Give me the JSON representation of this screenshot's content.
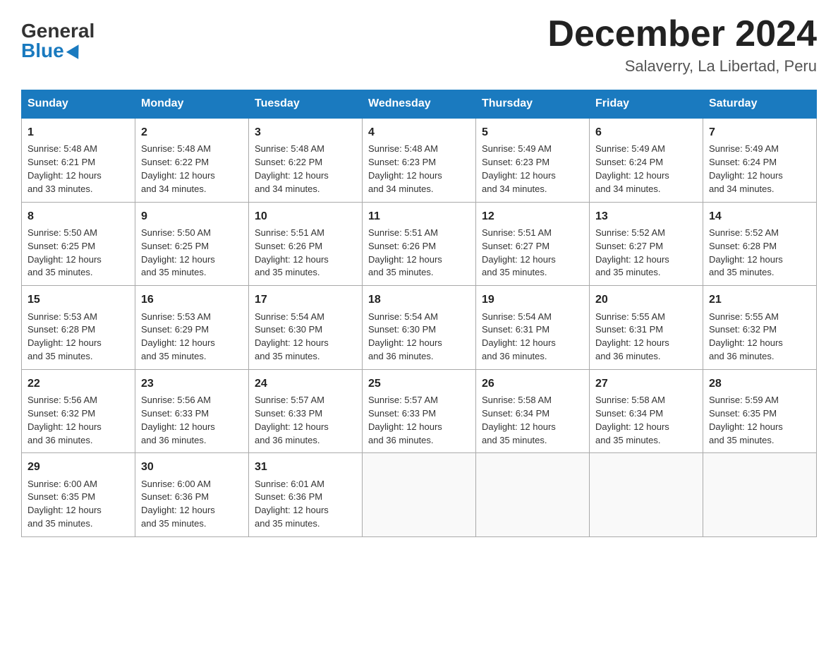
{
  "logo": {
    "general": "General",
    "blue": "Blue"
  },
  "title": "December 2024",
  "subtitle": "Salaverry, La Libertad, Peru",
  "days_of_week": [
    "Sunday",
    "Monday",
    "Tuesday",
    "Wednesday",
    "Thursday",
    "Friday",
    "Saturday"
  ],
  "weeks": [
    [
      {
        "day": "1",
        "sunrise": "5:48 AM",
        "sunset": "6:21 PM",
        "daylight": "12 hours and 33 minutes."
      },
      {
        "day": "2",
        "sunrise": "5:48 AM",
        "sunset": "6:22 PM",
        "daylight": "12 hours and 34 minutes."
      },
      {
        "day": "3",
        "sunrise": "5:48 AM",
        "sunset": "6:22 PM",
        "daylight": "12 hours and 34 minutes."
      },
      {
        "day": "4",
        "sunrise": "5:48 AM",
        "sunset": "6:23 PM",
        "daylight": "12 hours and 34 minutes."
      },
      {
        "day": "5",
        "sunrise": "5:49 AM",
        "sunset": "6:23 PM",
        "daylight": "12 hours and 34 minutes."
      },
      {
        "day": "6",
        "sunrise": "5:49 AM",
        "sunset": "6:24 PM",
        "daylight": "12 hours and 34 minutes."
      },
      {
        "day": "7",
        "sunrise": "5:49 AM",
        "sunset": "6:24 PM",
        "daylight": "12 hours and 34 minutes."
      }
    ],
    [
      {
        "day": "8",
        "sunrise": "5:50 AM",
        "sunset": "6:25 PM",
        "daylight": "12 hours and 35 minutes."
      },
      {
        "day": "9",
        "sunrise": "5:50 AM",
        "sunset": "6:25 PM",
        "daylight": "12 hours and 35 minutes."
      },
      {
        "day": "10",
        "sunrise": "5:51 AM",
        "sunset": "6:26 PM",
        "daylight": "12 hours and 35 minutes."
      },
      {
        "day": "11",
        "sunrise": "5:51 AM",
        "sunset": "6:26 PM",
        "daylight": "12 hours and 35 minutes."
      },
      {
        "day": "12",
        "sunrise": "5:51 AM",
        "sunset": "6:27 PM",
        "daylight": "12 hours and 35 minutes."
      },
      {
        "day": "13",
        "sunrise": "5:52 AM",
        "sunset": "6:27 PM",
        "daylight": "12 hours and 35 minutes."
      },
      {
        "day": "14",
        "sunrise": "5:52 AM",
        "sunset": "6:28 PM",
        "daylight": "12 hours and 35 minutes."
      }
    ],
    [
      {
        "day": "15",
        "sunrise": "5:53 AM",
        "sunset": "6:28 PM",
        "daylight": "12 hours and 35 minutes."
      },
      {
        "day": "16",
        "sunrise": "5:53 AM",
        "sunset": "6:29 PM",
        "daylight": "12 hours and 35 minutes."
      },
      {
        "day": "17",
        "sunrise": "5:54 AM",
        "sunset": "6:30 PM",
        "daylight": "12 hours and 35 minutes."
      },
      {
        "day": "18",
        "sunrise": "5:54 AM",
        "sunset": "6:30 PM",
        "daylight": "12 hours and 36 minutes."
      },
      {
        "day": "19",
        "sunrise": "5:54 AM",
        "sunset": "6:31 PM",
        "daylight": "12 hours and 36 minutes."
      },
      {
        "day": "20",
        "sunrise": "5:55 AM",
        "sunset": "6:31 PM",
        "daylight": "12 hours and 36 minutes."
      },
      {
        "day": "21",
        "sunrise": "5:55 AM",
        "sunset": "6:32 PM",
        "daylight": "12 hours and 36 minutes."
      }
    ],
    [
      {
        "day": "22",
        "sunrise": "5:56 AM",
        "sunset": "6:32 PM",
        "daylight": "12 hours and 36 minutes."
      },
      {
        "day": "23",
        "sunrise": "5:56 AM",
        "sunset": "6:33 PM",
        "daylight": "12 hours and 36 minutes."
      },
      {
        "day": "24",
        "sunrise": "5:57 AM",
        "sunset": "6:33 PM",
        "daylight": "12 hours and 36 minutes."
      },
      {
        "day": "25",
        "sunrise": "5:57 AM",
        "sunset": "6:33 PM",
        "daylight": "12 hours and 36 minutes."
      },
      {
        "day": "26",
        "sunrise": "5:58 AM",
        "sunset": "6:34 PM",
        "daylight": "12 hours and 35 minutes."
      },
      {
        "day": "27",
        "sunrise": "5:58 AM",
        "sunset": "6:34 PM",
        "daylight": "12 hours and 35 minutes."
      },
      {
        "day": "28",
        "sunrise": "5:59 AM",
        "sunset": "6:35 PM",
        "daylight": "12 hours and 35 minutes."
      }
    ],
    [
      {
        "day": "29",
        "sunrise": "6:00 AM",
        "sunset": "6:35 PM",
        "daylight": "12 hours and 35 minutes."
      },
      {
        "day": "30",
        "sunrise": "6:00 AM",
        "sunset": "6:36 PM",
        "daylight": "12 hours and 35 minutes."
      },
      {
        "day": "31",
        "sunrise": "6:01 AM",
        "sunset": "6:36 PM",
        "daylight": "12 hours and 35 minutes."
      },
      null,
      null,
      null,
      null
    ]
  ],
  "labels": {
    "sunrise": "Sunrise:",
    "sunset": "Sunset:",
    "daylight": "Daylight:"
  }
}
